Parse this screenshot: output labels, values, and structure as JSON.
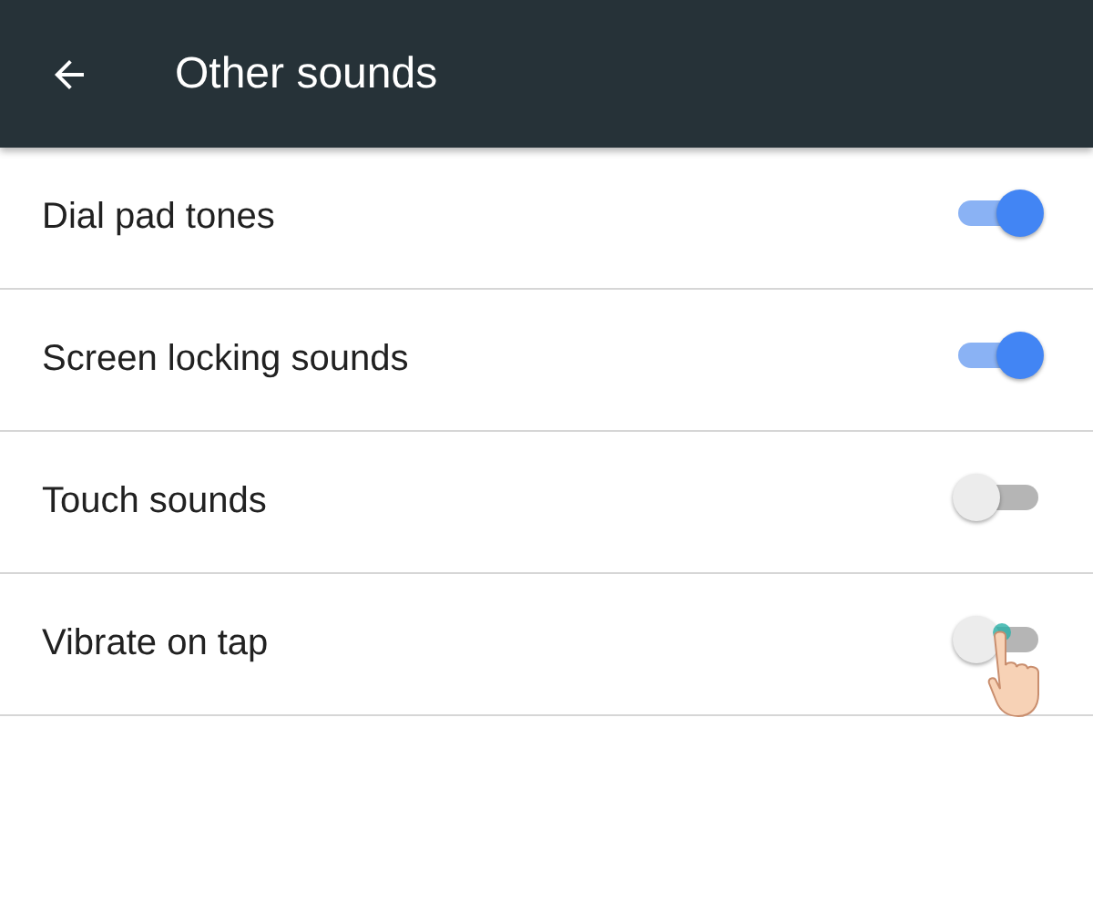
{
  "header": {
    "title": "Other sounds"
  },
  "settings": [
    {
      "label": "Dial pad tones",
      "on": true
    },
    {
      "label": "Screen locking sounds",
      "on": true
    },
    {
      "label": "Touch sounds",
      "on": false
    },
    {
      "label": "Vibrate on tap",
      "on": false,
      "tapped": true
    }
  ]
}
